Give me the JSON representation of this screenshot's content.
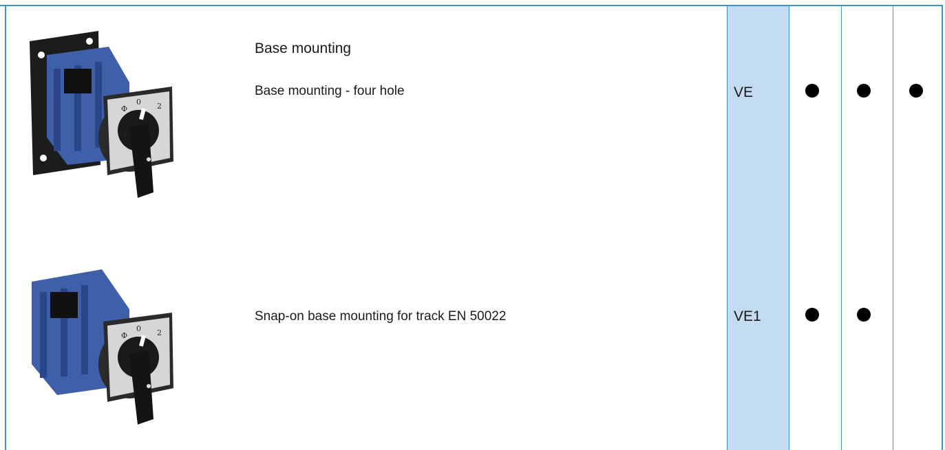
{
  "rows": [
    {
      "heading": "Base mounting",
      "description": "Base mounting - four hole",
      "code": "VE",
      "marks": [
        true,
        true,
        true
      ],
      "image": "rotary-cam-switch-four-hole-base-mount"
    },
    {
      "heading": "",
      "description": "Snap-on base mounting for track EN 50022",
      "code": "VE1",
      "marks": [
        true,
        true,
        false
      ],
      "image": "rotary-cam-switch-snap-on-track-mount"
    }
  ],
  "colors": {
    "border": "#3a8fcf",
    "code_column_bg": "#c3dcf1",
    "dot": "#000000",
    "switch_body": "#3f5fa8"
  }
}
